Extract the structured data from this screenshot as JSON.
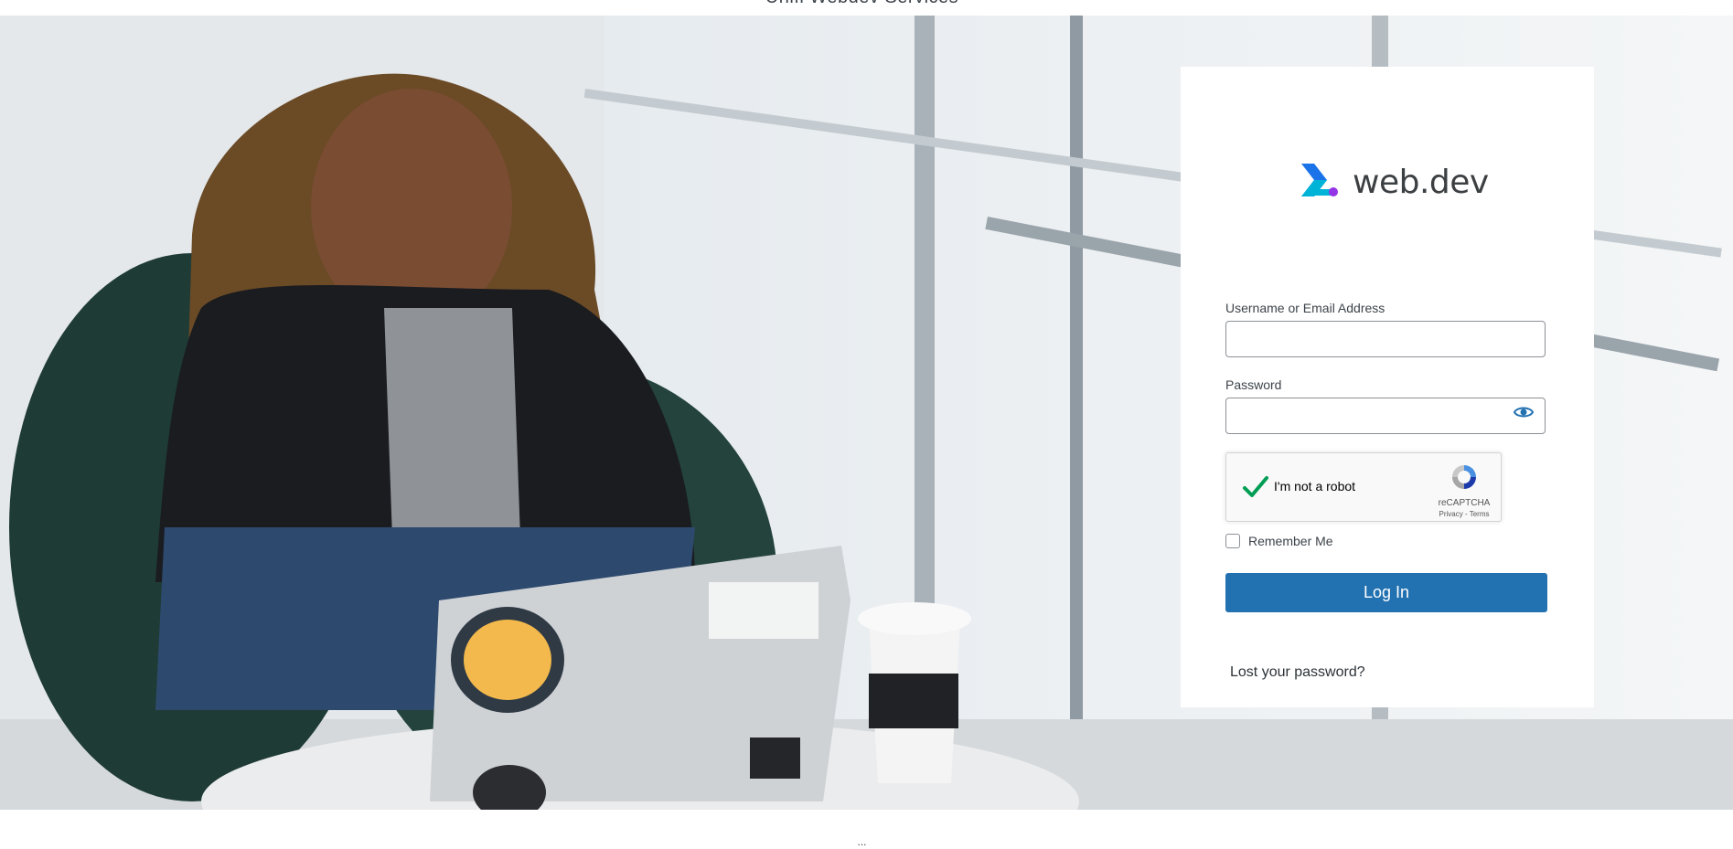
{
  "page": {
    "title": "Unifi Webdev Services",
    "footer_dots": "..."
  },
  "logo": {
    "text": "web.dev",
    "icon": "webdev-chevron-logo-icon"
  },
  "form": {
    "username_label": "Username or Email Address",
    "username_value": "",
    "password_label": "Password",
    "password_value": "",
    "show_password_icon": "eye-icon",
    "remember_label": "Remember Me",
    "remember_checked": false,
    "submit_label": "Log In",
    "lost_password_label": "Lost your password?"
  },
  "recaptcha": {
    "label": "I'm not a robot",
    "brand": "reCAPTCHA",
    "links": "Privacy - Terms",
    "checked": true
  },
  "colors": {
    "primary_button": "#2271b1",
    "eye_icon": "#2271b1",
    "checkmark": "#009e55",
    "logo_blue": "#1a73e8",
    "logo_cyan": "#00b4d8",
    "logo_purple": "#9334e6"
  }
}
